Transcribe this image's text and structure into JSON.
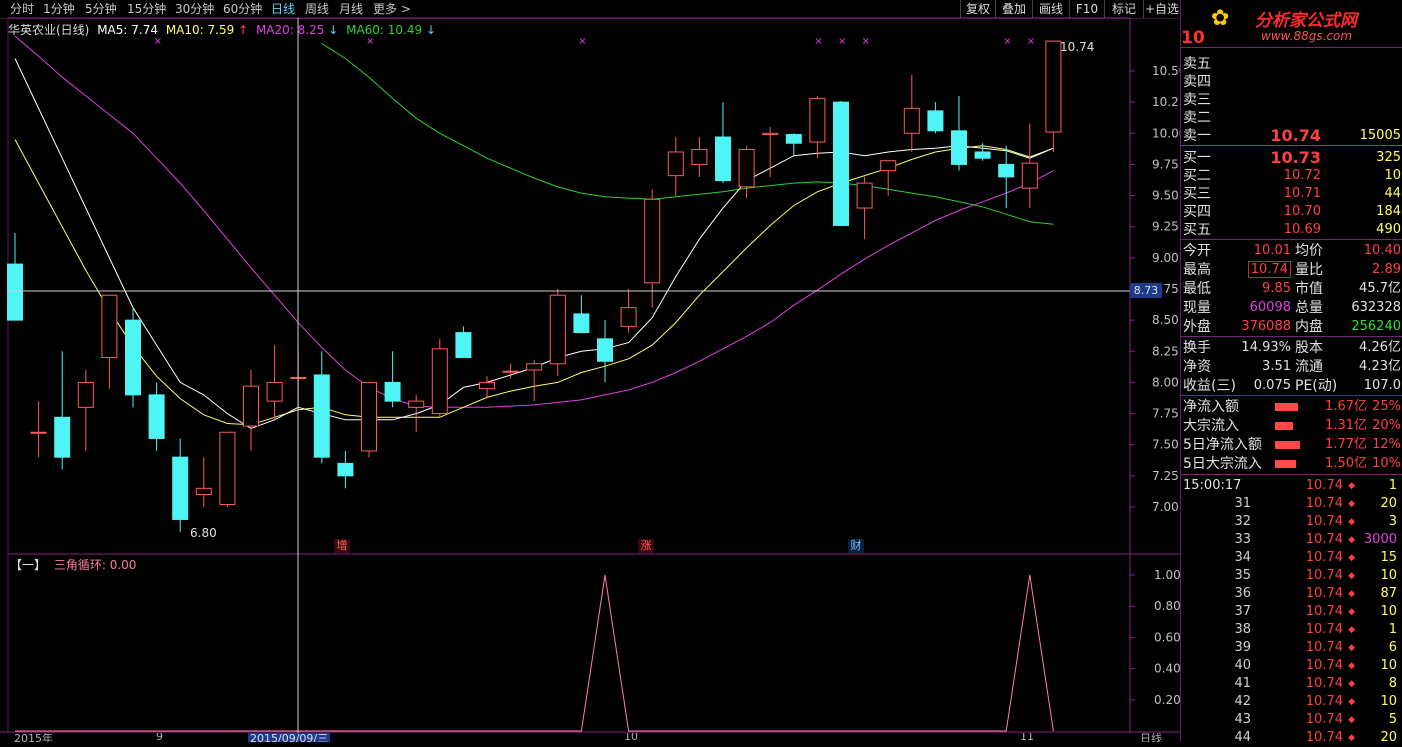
{
  "toolbar": {
    "periods": [
      "分时",
      "1分钟",
      "5分钟",
      "15分钟",
      "30分钟",
      "60分钟",
      "日线",
      "周线",
      "月线",
      "更多 >"
    ],
    "active_index": 6,
    "right_buttons": [
      "复权",
      "叠加",
      "画线",
      "F10",
      "标记",
      "+自选"
    ]
  },
  "brand": {
    "name": "分析家公式网",
    "url": "www.88gs.com"
  },
  "legend": {
    "stock": "华英农业(日线)",
    "ma5": "MA5: 7.74",
    "ma10": "MA10: 7.59",
    "ma20": "MA20: 8.25",
    "ma60": "MA60: 10.49",
    "arrow_up": "↑",
    "arrow_down": "↓"
  },
  "colors": {
    "ma5": "#ffffff",
    "ma10": "#ffff66",
    "ma20": "#e040e0",
    "ma60": "#30d030",
    "up": "#ff5b5b",
    "down": "#4ff4f4",
    "frame": "#8a1f8a",
    "indicator": "#ff7fa0"
  },
  "annotations": {
    "high_label": "10.74",
    "low_label": "6.80",
    "price_marker": "8.73",
    "events": [
      "增",
      "涨",
      "财"
    ],
    "cross_mark": "×"
  },
  "indicator": {
    "title": "【一】",
    "name": "三角循环: 0.00"
  },
  "bottom_axis": {
    "labels": [
      "2015年",
      "9",
      "2015/09/09/三",
      "10",
      "11",
      "日线"
    ]
  },
  "chart_data": {
    "type": "candlestick",
    "ylim": [
      6.7,
      10.8
    ],
    "yticks": [
      7.0,
      7.25,
      7.5,
      7.75,
      8.0,
      8.25,
      8.5,
      8.75,
      9.0,
      9.25,
      9.5,
      9.75,
      10.0,
      10.25,
      10.5
    ],
    "candles": [
      {
        "o": 8.95,
        "h": 9.2,
        "l": 8.5,
        "c": 8.5
      },
      {
        "o": 7.6,
        "h": 7.85,
        "l": 7.4,
        "c": 7.6
      },
      {
        "o": 7.72,
        "h": 8.25,
        "l": 7.3,
        "c": 7.4
      },
      {
        "o": 7.8,
        "h": 8.1,
        "l": 7.45,
        "c": 8.0
      },
      {
        "o": 8.2,
        "h": 8.7,
        "l": 7.95,
        "c": 8.7
      },
      {
        "o": 8.5,
        "h": 8.6,
        "l": 7.8,
        "c": 7.9
      },
      {
        "o": 7.9,
        "h": 8.0,
        "l": 7.45,
        "c": 7.55
      },
      {
        "o": 7.4,
        "h": 7.55,
        "l": 6.8,
        "c": 6.9
      },
      {
        "o": 7.1,
        "h": 7.4,
        "l": 7.0,
        "c": 7.15
      },
      {
        "o": 7.02,
        "h": 7.6,
        "l": 7.0,
        "c": 7.6
      },
      {
        "o": 7.65,
        "h": 8.1,
        "l": 7.45,
        "c": 7.97
      },
      {
        "o": 7.85,
        "h": 8.3,
        "l": 7.7,
        "c": 8.0
      },
      {
        "o": 8.04,
        "h": 8.25,
        "l": 7.8,
        "c": 8.04
      },
      {
        "o": 8.06,
        "h": 8.25,
        "l": 7.35,
        "c": 7.4
      },
      {
        "o": 7.35,
        "h": 7.45,
        "l": 7.15,
        "c": 7.25
      },
      {
        "o": 7.45,
        "h": 8.0,
        "l": 7.4,
        "c": 8.0
      },
      {
        "o": 8.0,
        "h": 8.25,
        "l": 7.8,
        "c": 7.85
      },
      {
        "o": 7.8,
        "h": 7.9,
        "l": 7.6,
        "c": 7.85
      },
      {
        "o": 7.75,
        "h": 8.35,
        "l": 7.72,
        "c": 8.27
      },
      {
        "o": 8.4,
        "h": 8.45,
        "l": 8.2,
        "c": 8.2
      },
      {
        "o": 7.95,
        "h": 8.05,
        "l": 7.88,
        "c": 8.0
      },
      {
        "o": 8.09,
        "h": 8.15,
        "l": 8.03,
        "c": 8.09
      },
      {
        "o": 8.1,
        "h": 8.18,
        "l": 7.85,
        "c": 8.15
      },
      {
        "o": 8.15,
        "h": 8.75,
        "l": 8.05,
        "c": 8.7
      },
      {
        "o": 8.55,
        "h": 8.7,
        "l": 8.4,
        "c": 8.4
      },
      {
        "o": 8.35,
        "h": 8.5,
        "l": 8.0,
        "c": 8.17
      },
      {
        "o": 8.45,
        "h": 8.75,
        "l": 8.4,
        "c": 8.6
      },
      {
        "o": 8.8,
        "h": 9.55,
        "l": 8.6,
        "c": 9.47
      },
      {
        "o": 9.66,
        "h": 9.97,
        "l": 9.5,
        "c": 9.85
      },
      {
        "o": 9.75,
        "h": 9.97,
        "l": 9.65,
        "c": 9.87
      },
      {
        "o": 9.97,
        "h": 10.25,
        "l": 9.6,
        "c": 9.62
      },
      {
        "o": 9.57,
        "h": 9.9,
        "l": 9.48,
        "c": 9.87
      },
      {
        "o": 9.99,
        "h": 10.05,
        "l": 9.65,
        "c": 10.0
      },
      {
        "o": 9.99,
        "h": 10.0,
        "l": 9.82,
        "c": 9.92
      },
      {
        "o": 9.93,
        "h": 10.3,
        "l": 9.8,
        "c": 10.28
      },
      {
        "o": 10.25,
        "h": 10.26,
        "l": 9.26,
        "c": 9.26
      },
      {
        "o": 9.4,
        "h": 9.65,
        "l": 9.15,
        "c": 9.6
      },
      {
        "o": 9.7,
        "h": 9.75,
        "l": 9.5,
        "c": 9.78
      },
      {
        "o": 10.0,
        "h": 10.47,
        "l": 9.85,
        "c": 10.2
      },
      {
        "o": 10.18,
        "h": 10.25,
        "l": 10.0,
        "c": 10.02
      },
      {
        "o": 10.02,
        "h": 10.3,
        "l": 9.7,
        "c": 9.75
      },
      {
        "o": 9.85,
        "h": 9.92,
        "l": 9.78,
        "c": 9.8
      },
      {
        "o": 9.75,
        "h": 9.9,
        "l": 9.4,
        "c": 9.65
      },
      {
        "o": 9.56,
        "h": 10.08,
        "l": 9.4,
        "c": 9.76
      },
      {
        "o": 10.01,
        "h": 10.74,
        "l": 9.85,
        "c": 10.74
      }
    ],
    "ma5": [
      10.6,
      10.2,
      9.8,
      9.4,
      9.0,
      8.6,
      8.3,
      8.0,
      7.9,
      7.75,
      7.63,
      7.7,
      7.8,
      7.75,
      7.7,
      7.7,
      7.7,
      7.75,
      7.82,
      7.96,
      8.0,
      8.06,
      8.12,
      8.2,
      8.25,
      8.27,
      8.32,
      8.52,
      8.85,
      9.15,
      9.4,
      9.62,
      9.72,
      9.82,
      9.84,
      9.85,
      9.82,
      9.85,
      9.87,
      9.88,
      9.9,
      9.88,
      9.86,
      9.8,
      9.88
    ],
    "ma10": [
      9.95,
      9.6,
      9.25,
      8.9,
      8.58,
      8.29,
      8.05,
      7.87,
      7.74,
      7.67,
      7.66,
      7.72,
      7.78,
      7.8,
      7.74,
      7.72,
      7.72,
      7.72,
      7.72,
      7.8,
      7.88,
      7.93,
      7.97,
      8.0,
      8.08,
      8.13,
      8.19,
      8.3,
      8.48,
      8.7,
      8.89,
      9.08,
      9.26,
      9.42,
      9.53,
      9.6,
      9.66,
      9.72,
      9.79,
      9.85,
      9.88,
      9.9,
      9.87,
      9.81,
      9.88
    ],
    "ma20": [
      10.78,
      10.62,
      10.45,
      10.3,
      10.15,
      10.0,
      9.8,
      9.6,
      9.38,
      9.15,
      8.92,
      8.7,
      8.48,
      8.28,
      8.1,
      7.96,
      7.87,
      7.81,
      7.8,
      7.8,
      7.8,
      7.81,
      7.82,
      7.84,
      7.86,
      7.9,
      7.94,
      8.0,
      8.08,
      8.17,
      8.27,
      8.37,
      8.48,
      8.62,
      8.74,
      8.87,
      8.99,
      9.1,
      9.2,
      9.3,
      9.38,
      9.45,
      9.52,
      9.6,
      9.7
    ],
    "ma60": [
      null,
      null,
      null,
      null,
      null,
      null,
      null,
      null,
      null,
      null,
      null,
      null,
      null,
      10.72,
      10.6,
      10.45,
      10.28,
      10.12,
      10.0,
      9.9,
      9.8,
      9.72,
      9.64,
      9.57,
      9.52,
      9.49,
      9.48,
      9.47,
      9.49,
      9.51,
      9.53,
      9.56,
      9.58,
      9.6,
      9.61,
      9.6,
      9.58,
      9.55,
      9.52,
      9.49,
      9.45,
      9.41,
      9.35,
      9.29,
      9.27
    ],
    "indicator_values": [
      0,
      0,
      0,
      0,
      0,
      0,
      0,
      0,
      0,
      0,
      0,
      0,
      0,
      0,
      0,
      0,
      0,
      0,
      0,
      0,
      0,
      0,
      0,
      0,
      0,
      1,
      0,
      0,
      0,
      0,
      0,
      0,
      0,
      0,
      0,
      0,
      0,
      0,
      0,
      0,
      0,
      0,
      0,
      1,
      0
    ],
    "indicator_ylim": [
      0,
      1.1
    ],
    "indicator_yticks": [
      0.2,
      0.4,
      0.6,
      0.8,
      1.0
    ]
  },
  "quote": {
    "code_prefix": "10",
    "ask": [
      {
        "label": "卖五",
        "price": "",
        "vol": ""
      },
      {
        "label": "卖四",
        "price": "",
        "vol": ""
      },
      {
        "label": "卖三",
        "price": "",
        "vol": ""
      },
      {
        "label": "卖二",
        "price": "",
        "vol": ""
      },
      {
        "label": "卖一",
        "price": "10.74",
        "vol": "15005"
      }
    ],
    "bid": [
      {
        "label": "买一",
        "price": "10.73",
        "vol": "325"
      },
      {
        "label": "买二",
        "price": "10.72",
        "vol": "10"
      },
      {
        "label": "买三",
        "price": "10.71",
        "vol": "44"
      },
      {
        "label": "买四",
        "price": "10.70",
        "vol": "184"
      },
      {
        "label": "买五",
        "price": "10.69",
        "vol": "490"
      }
    ],
    "stats": [
      {
        "l1": "今开",
        "v1": "10.01",
        "l2": "均价",
        "v2": "10.40"
      },
      {
        "l1": "最高",
        "v1": "10.74",
        "l2": "量比",
        "v2": "2.89"
      },
      {
        "l1": "最低",
        "v1": "9.85",
        "l2": "市值",
        "v2": "45.7亿"
      },
      {
        "l1": "现量",
        "v1": "60098",
        "l2": "总量",
        "v2": "632328"
      },
      {
        "l1": "外盘",
        "v1": "376088",
        "l2": "内盘",
        "v2": "256240"
      }
    ],
    "stats2": [
      {
        "l1": "换手",
        "v1": "14.93%",
        "l2": "股本",
        "v2": "4.26亿"
      },
      {
        "l1": "净资",
        "v1": "3.51",
        "l2": "流通",
        "v2": "4.23亿"
      },
      {
        "l1": "收益(三)",
        "v1": "0.075",
        "l2": "PE(动)",
        "v2": "107.0"
      }
    ],
    "flows": [
      {
        "label": "净流入额",
        "amount": "1.67亿",
        "pct": "25%",
        "bar": 0.5
      },
      {
        "label": "大宗流入",
        "amount": "1.31亿",
        "pct": "20%",
        "bar": 0.4
      },
      {
        "label": "5日净流入额",
        "amount": "1.77亿",
        "pct": "12%",
        "bar": 0.55
      },
      {
        "label": "5日大宗流入",
        "amount": "1.50亿",
        "pct": "10%",
        "bar": 0.45
      }
    ],
    "ticks_first_time": "15:00:17",
    "ticks": [
      {
        "t": "",
        "p": "10.74",
        "v": "1"
      },
      {
        "t": "31",
        "p": "10.74",
        "v": "20"
      },
      {
        "t": "32",
        "p": "10.74",
        "v": "3"
      },
      {
        "t": "33",
        "p": "10.74",
        "v": "3000"
      },
      {
        "t": "34",
        "p": "10.74",
        "v": "15"
      },
      {
        "t": "35",
        "p": "10.74",
        "v": "10"
      },
      {
        "t": "36",
        "p": "10.74",
        "v": "87"
      },
      {
        "t": "37",
        "p": "10.74",
        "v": "10"
      },
      {
        "t": "38",
        "p": "10.74",
        "v": "1"
      },
      {
        "t": "39",
        "p": "10.74",
        "v": "6"
      },
      {
        "t": "40",
        "p": "10.74",
        "v": "10"
      },
      {
        "t": "41",
        "p": "10.74",
        "v": "8"
      },
      {
        "t": "42",
        "p": "10.74",
        "v": "10"
      },
      {
        "t": "43",
        "p": "10.74",
        "v": "5"
      },
      {
        "t": "44",
        "p": "10.74",
        "v": "20"
      }
    ],
    "tick_dir": "◆"
  }
}
